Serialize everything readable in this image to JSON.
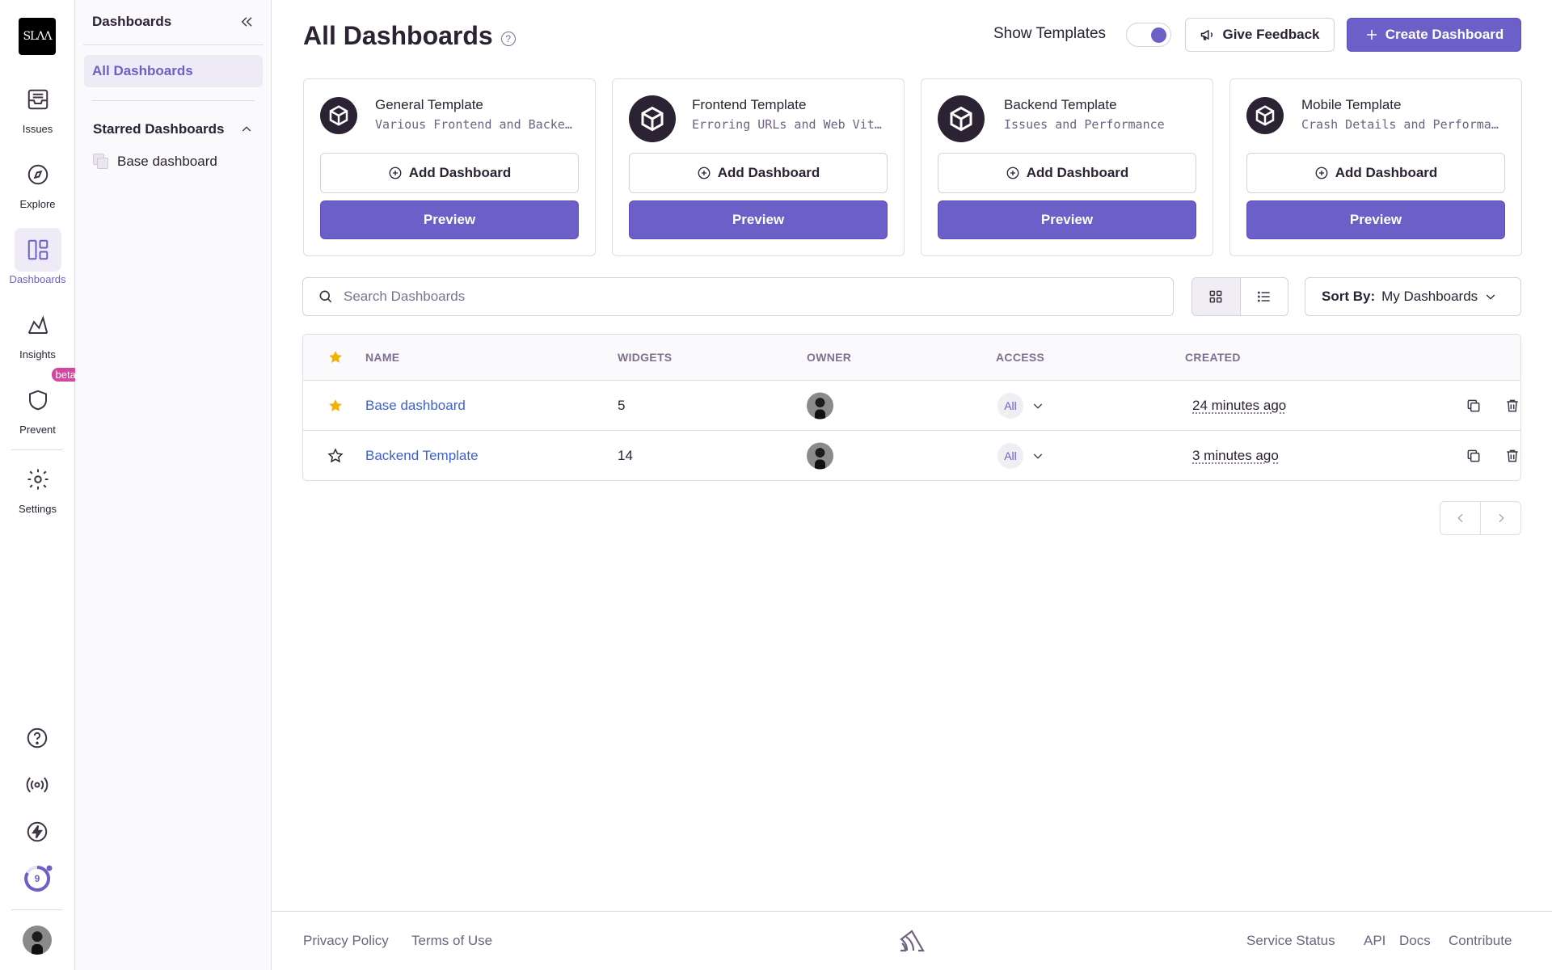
{
  "org": {
    "logo_text": "SLΛΛ"
  },
  "rail": {
    "items": [
      {
        "label": "Issues"
      },
      {
        "label": "Explore"
      },
      {
        "label": "Dashboards"
      },
      {
        "label": "Insights"
      },
      {
        "label": "Prevent",
        "badge": "beta"
      },
      {
        "label": "Settings"
      }
    ],
    "onboarding_count": "9"
  },
  "sidebar": {
    "title": "Dashboards",
    "all_label": "All Dashboards",
    "starred_title": "Starred Dashboards",
    "starred_items": [
      "Base dashboard"
    ]
  },
  "header": {
    "title": "All Dashboards",
    "show_templates_label": "Show Templates",
    "show_templates_on": true,
    "feedback_label": "Give Feedback",
    "create_label": "Create Dashboard"
  },
  "templates": [
    {
      "name": "General Template",
      "description": "Various Frontend and Backend Widgets",
      "add_label": "Add Dashboard",
      "preview_label": "Preview"
    },
    {
      "name": "Frontend Template",
      "description": "Erroring URLs and Web Vitals",
      "add_label": "Add Dashboard",
      "preview_label": "Preview"
    },
    {
      "name": "Backend Template",
      "description": "Issues and Performance",
      "add_label": "Add Dashboard",
      "preview_label": "Preview"
    },
    {
      "name": "Mobile Template",
      "description": "Crash Details and Performance Vitals",
      "add_label": "Add Dashboard",
      "preview_label": "Preview"
    }
  ],
  "search": {
    "placeholder": "Search Dashboards"
  },
  "sort": {
    "label": "Sort By:",
    "value": "My Dashboards"
  },
  "table": {
    "headers": {
      "name": "NAME",
      "widgets": "WIDGETS",
      "owner": "OWNER",
      "access": "ACCESS",
      "created": "CREATED"
    },
    "rows": [
      {
        "starred": true,
        "name": "Base dashboard",
        "widgets": "5",
        "access": "All",
        "created": "24 minutes ago"
      },
      {
        "starred": false,
        "name": "Backend Template",
        "widgets": "14",
        "access": "All",
        "created": "3 minutes ago"
      }
    ]
  },
  "footer": {
    "left": [
      "Privacy Policy",
      "Terms of Use"
    ],
    "right": [
      "Service Status",
      "API",
      "Docs",
      "Contribute"
    ]
  },
  "colors": {
    "accent": "#6c5fc7",
    "link": "#3e62c9",
    "star": "#f5b000",
    "beta": "#d3479d"
  }
}
